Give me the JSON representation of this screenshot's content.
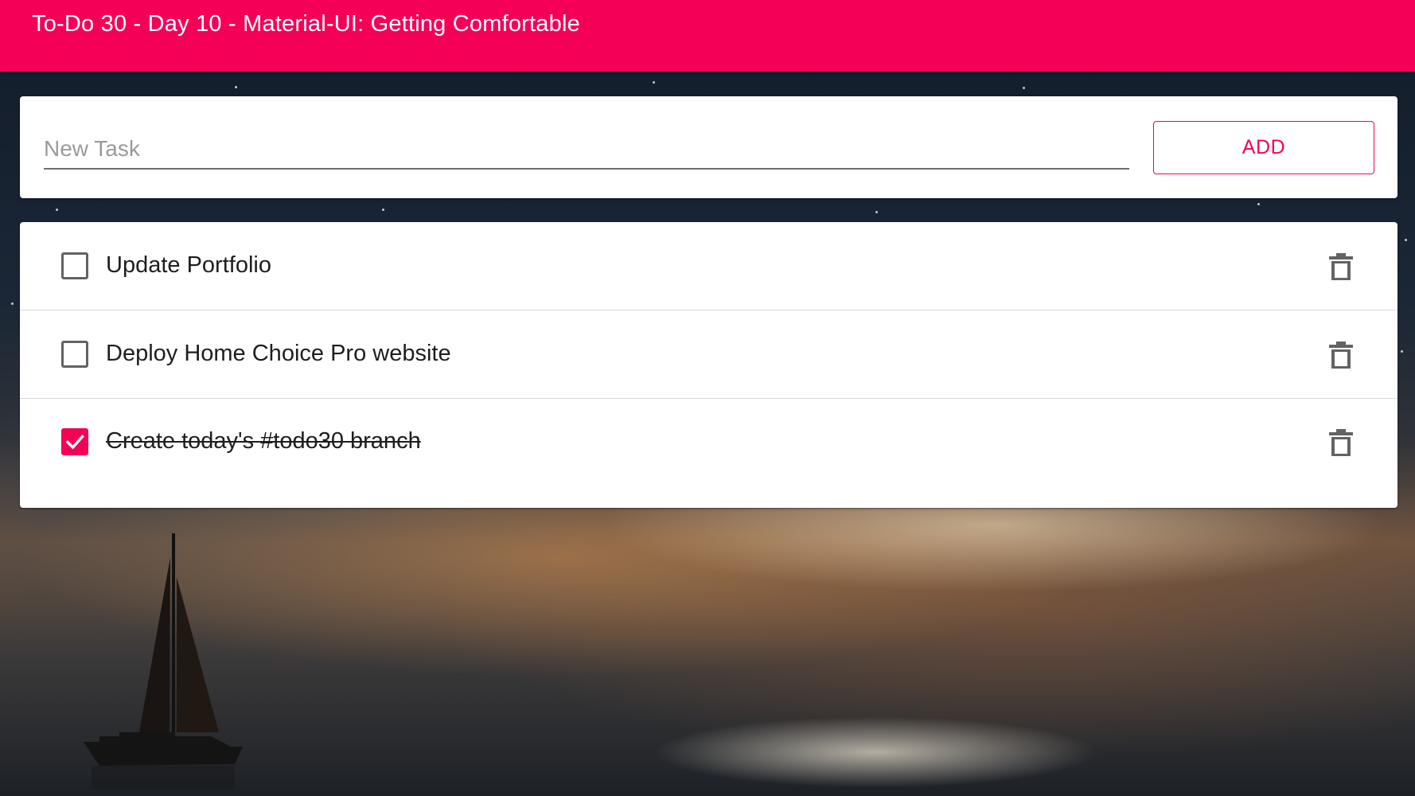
{
  "app": {
    "title": "To-Do 30 - Day 10 - Material-UI: Getting Comfortable"
  },
  "new_task": {
    "value": "",
    "placeholder": "New Task",
    "add_label": "ADD"
  },
  "tasks": [
    {
      "label": "Update Portfolio",
      "completed": false
    },
    {
      "label": "Deploy Home Choice Pro website",
      "completed": false
    },
    {
      "label": "Create today's #todo30 branch",
      "completed": true
    }
  ],
  "icons": {
    "checkbox_unchecked": "checkbox-unchecked-icon",
    "checkbox_checked": "checkbox-checked-icon",
    "delete": "trash-icon",
    "background": "sailboat-sunset-scene"
  },
  "colors": {
    "accent": "#f50057",
    "card": "#ffffff",
    "text": "#1e1e1e",
    "placeholder": "#9a9a9a",
    "icon": "#636363"
  }
}
